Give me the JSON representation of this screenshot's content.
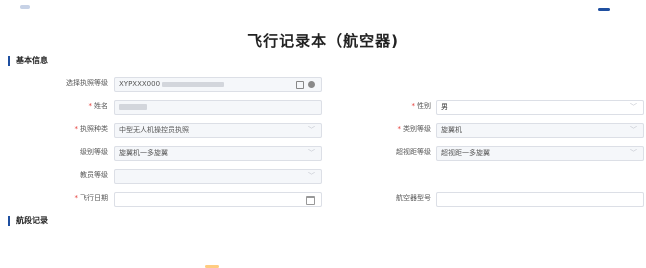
{
  "page": {
    "title": "飞行记录本（航空器)"
  },
  "sections": {
    "basic_info": "基本信息",
    "flight_segment": "航段记录"
  },
  "form": {
    "license_level": {
      "label": "选择执照等级",
      "value": "XYPXXX000"
    },
    "name": {
      "label": "姓名",
      "value": ""
    },
    "gender": {
      "label": "性别",
      "value": "男"
    },
    "license_type": {
      "label": "执照种类",
      "value": "中型无人机操控员执照"
    },
    "category_level": {
      "label": "类别等级",
      "value": "旋翼机"
    },
    "class_level": {
      "label": "级别等级",
      "value": "旋翼机一多旋翼"
    },
    "bvlos_level": {
      "label": "超视距等级",
      "value": "超视距一多旋翼"
    },
    "instructor_level": {
      "label": "教员等级",
      "value": ""
    },
    "flight_date": {
      "label": "飞行日期",
      "value": ""
    },
    "aircraft_model": {
      "label": "航空器型号",
      "value": ""
    }
  },
  "icons": {
    "edit": "edit-icon",
    "clear": "clear-icon",
    "calendar": "calendar-icon",
    "chevron": "chevron-down-icon"
  },
  "colors": {
    "accent": "#1f4fa0",
    "required": "#e53935",
    "border": "#dcdfe6",
    "disabled_bg": "#f5f7fa"
  }
}
